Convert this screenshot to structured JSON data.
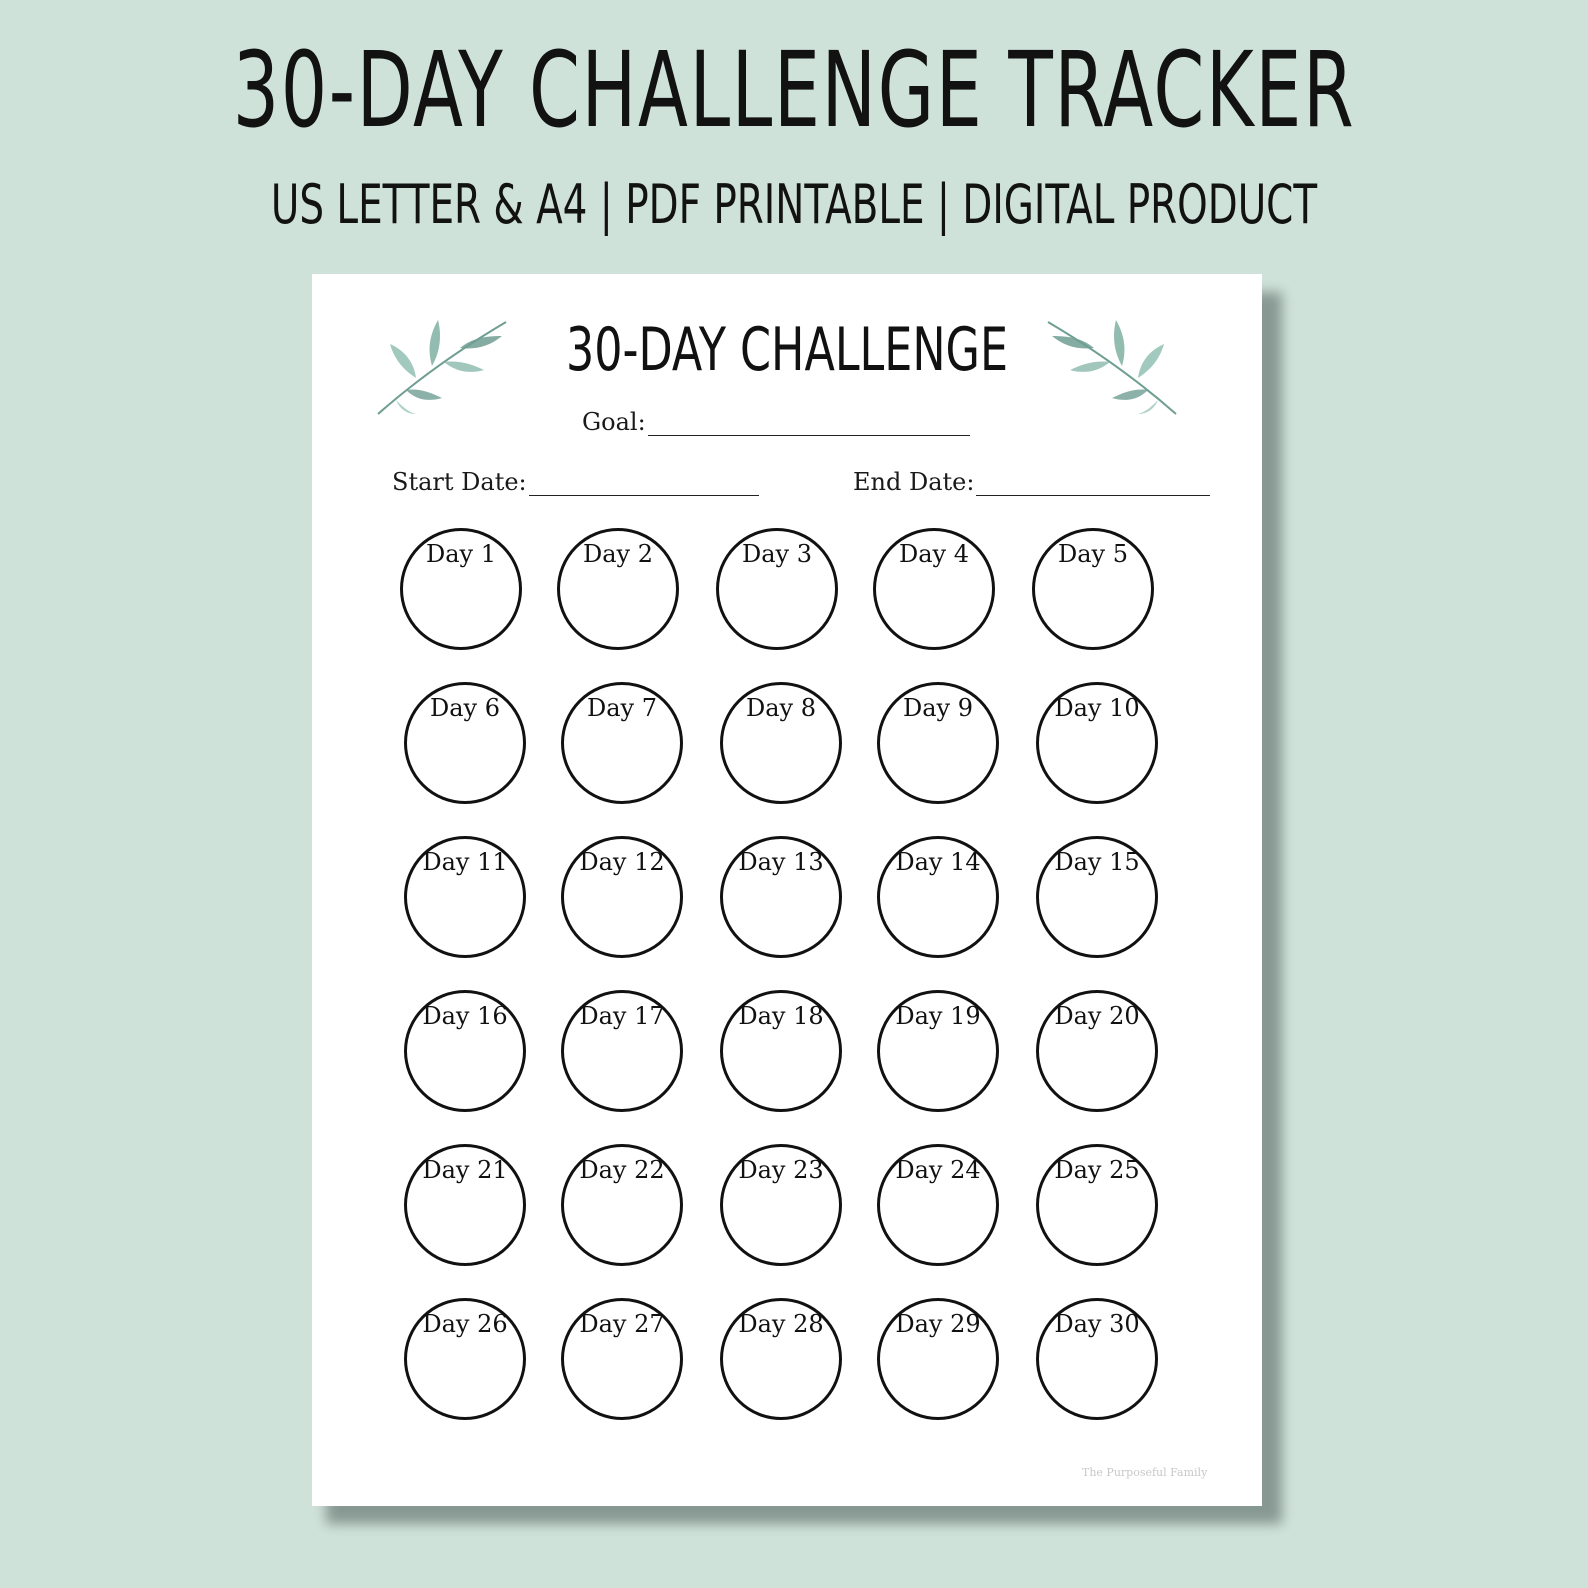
{
  "banner": {
    "title": "30-DAY CHALLENGE TRACKER",
    "subtitle": "US LETTER & A4 | PDF PRINTABLE | DIGITAL PRODUCT"
  },
  "sheet": {
    "title": "30-DAY CHALLENGE",
    "goal_label": "Goal:",
    "start_label": "Start Date:",
    "end_label": "End Date:",
    "watermark": "The Purposeful Family",
    "days": [
      "Day 1",
      "Day 2",
      "Day 3",
      "Day 4",
      "Day 5",
      "Day 6",
      "Day 7",
      "Day 8",
      "Day 9",
      "Day 10",
      "Day 11",
      "Day 12",
      "Day 13",
      "Day 14",
      "Day 15",
      "Day 16",
      "Day 17",
      "Day 18",
      "Day 19",
      "Day 20",
      "Day 21",
      "Day 22",
      "Day 23",
      "Day 24",
      "Day 25",
      "Day 26",
      "Day 27",
      "Day 28",
      "Day 29",
      "Day 30"
    ]
  },
  "colors": {
    "background": "#cfe2da",
    "sheet": "#ffffff",
    "leaf": "#6f9e92",
    "ink": "#111111"
  },
  "icons": {
    "left_decoration": "leaf-sprig-icon",
    "right_decoration": "leaf-sprig-icon"
  }
}
